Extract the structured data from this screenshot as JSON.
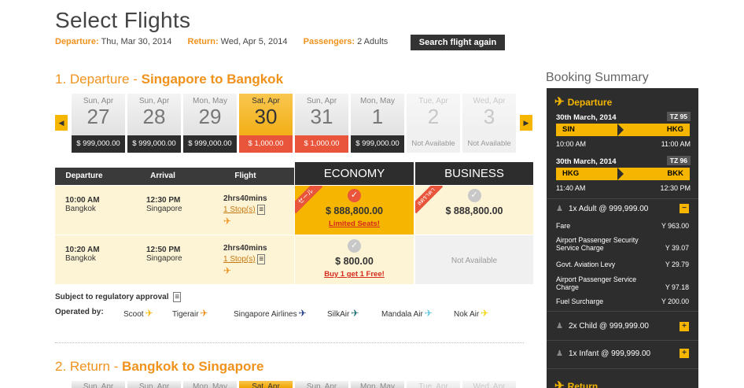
{
  "header": {
    "title": "Select Flights",
    "departure_label": "Departure:",
    "departure_value": "Thu, Mar 30, 2014",
    "return_label": "Return:",
    "return_value": "Wed, Apr 5, 2014",
    "passengers_label": "Passengers:",
    "passengers_value": "2 Adults",
    "search_again": "Search flight again"
  },
  "departure_section": {
    "prefix": "1. Departure - ",
    "route": "Singapore to Bangkok"
  },
  "return_section": {
    "prefix": "2. Return - ",
    "route": "Bangkok to Singapore"
  },
  "date_strip": [
    {
      "dow": "Sun, Apr",
      "day": "27",
      "price": "$ 999,000.00",
      "state": "normal"
    },
    {
      "dow": "Sun, Apr",
      "day": "28",
      "price": "$ 999,000.00",
      "state": "normal"
    },
    {
      "dow": "Mon, May",
      "day": "29",
      "price": "$ 999,000.00",
      "state": "normal"
    },
    {
      "dow": "Sat, Apr",
      "day": "30",
      "price": "$ 1,000.00",
      "state": "selected"
    },
    {
      "dow": "Sun, Apr",
      "day": "31",
      "price": "$ 1,000.00",
      "state": "hot"
    },
    {
      "dow": "Mon, May",
      "day": "1",
      "price": "$ 999,000.00",
      "state": "normal"
    },
    {
      "dow": "Tue, Apr",
      "day": "2",
      "price": "Not Available",
      "state": "na"
    },
    {
      "dow": "Wed, Apr",
      "day": "3",
      "price": "Not Available",
      "state": "na"
    }
  ],
  "return_strip": [
    "Sun, Apr",
    "Sun, Apr",
    "Mon, May",
    "Sat, Apr",
    "Sun, Apr",
    "Mon, May",
    "Tue, Apr",
    "Wed, Apr"
  ],
  "table": {
    "col_departure": "Departure",
    "col_arrival": "Arrival",
    "col_flight": "Flight",
    "col_economy": "ECONOMY",
    "col_business": "BUSINESS",
    "rows": [
      {
        "dep_time": "10:00 AM",
        "dep_city": "Bangkok",
        "arr_time": "12:30 PM",
        "arr_city": "Singapore",
        "duration": "2hrs40mins",
        "stops": "1 Stop(s)",
        "economy_price": "$ 888,800.00",
        "economy_promo": "Limited Seats!",
        "economy_ribbon": "セール",
        "business_price": "$ 888,800.00",
        "business_ribbon": "ลดราคา"
      },
      {
        "dep_time": "10:20 AM",
        "dep_city": "Bangkok",
        "arr_time": "12:50 PM",
        "arr_city": "Singapore",
        "duration": "2hrs40mins",
        "stops": "1 Stop(s)",
        "economy_price": "$ 800.00",
        "economy_promo": "Buy 1 get 1 Free!",
        "business_price": "Not Available"
      }
    ]
  },
  "regulatory": "Subject to regulatory approval",
  "operated_by": {
    "label": "Operated by:",
    "airlines": [
      "Scoot",
      "Tigerair",
      "Singapore Airlines",
      "SilkAir",
      "Mandala Air",
      "Nok Air"
    ],
    "colors": [
      "#f5b500",
      "#f0921c",
      "#1f3c88",
      "#1f6f7a",
      "#5bc8e0",
      "#f5d300"
    ]
  },
  "summary": {
    "title": "Booking Summary",
    "departure_label": "Departure",
    "return_label": "Return",
    "legs": [
      {
        "date": "30th March, 2014",
        "flight": "TZ 95",
        "from": "SIN",
        "to": "HKG",
        "dep": "10:00 AM",
        "arr": "11:00 AM"
      },
      {
        "date": "30th March, 2014",
        "flight": "TZ 96",
        "from": "HKG",
        "to": "BKK",
        "dep": "11:40 AM",
        "arr": "12:30 PM"
      }
    ],
    "adult": "1x Adult @ 999,999.00",
    "child": "2x Child @ 999,999.00",
    "infant": "1x Infant @ 999,999.00",
    "fees": [
      {
        "label": "Fare",
        "value": "Y 963.00"
      },
      {
        "label": "Airport Passenger Security Service Charge",
        "value": "Y 39.07"
      },
      {
        "label": "Govt. Aviation Levy",
        "value": "Y 29.79"
      },
      {
        "label": "Airport Passenger Service Charge",
        "value": "Y 97.18"
      },
      {
        "label": "Fuel Surcharge",
        "value": "Y 200.00"
      }
    ],
    "accent": "#f5b500"
  }
}
